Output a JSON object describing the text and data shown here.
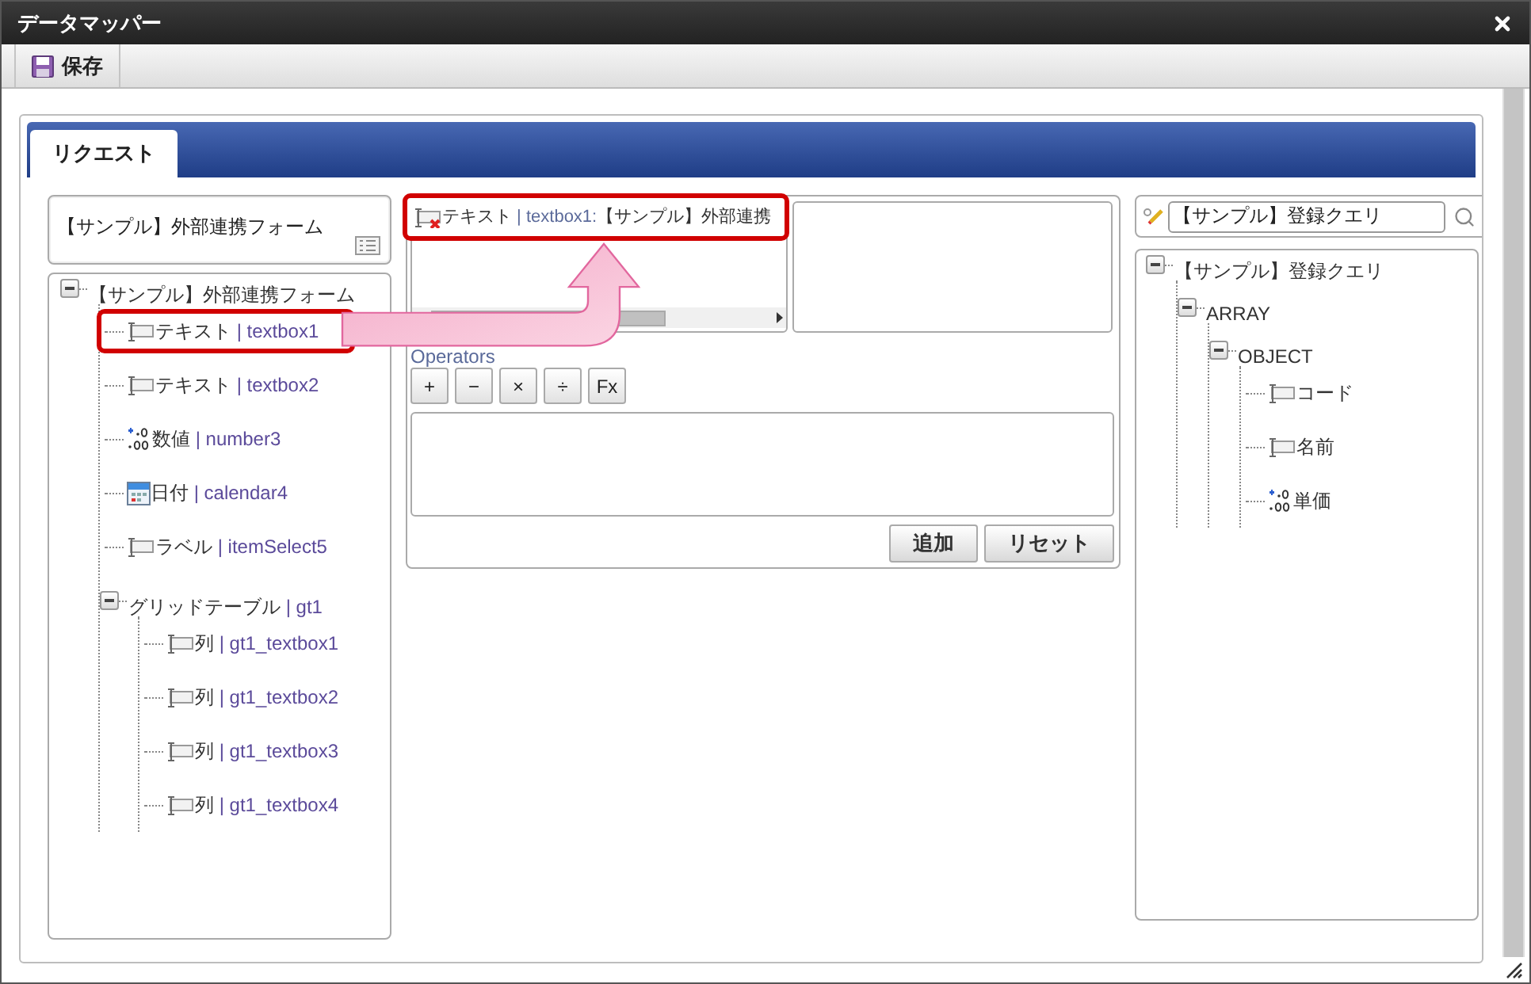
{
  "window": {
    "title": "データマッパー"
  },
  "toolbar": {
    "save_button": "保存"
  },
  "tabs": [
    {
      "label": "リクエスト",
      "selected": true
    }
  ],
  "source": {
    "title": "【サンプル】外部連携フォーム",
    "tree": [
      {
        "label": "【サンプル】外部連携フォーム",
        "expanded": true,
        "children": [
          {
            "kind": "text",
            "label": "テキスト",
            "ref": "| textbox1",
            "highlighted": true
          },
          {
            "kind": "text",
            "label": "テキスト",
            "ref": "| textbox2",
            "highlighted": false
          },
          {
            "kind": "number",
            "label": "数値",
            "ref": "| number3",
            "highlighted": false
          },
          {
            "kind": "date",
            "label": "日付",
            "ref": "| calendar4",
            "highlighted": false
          },
          {
            "kind": "text",
            "label": "ラベル",
            "ref": "| itemSelect5",
            "highlighted": false
          },
          {
            "label": "グリッドテーブル",
            "ref": "| gt1",
            "expanded": true,
            "children": [
              {
                "kind": "text",
                "label": "列",
                "ref": "| gt1_textbox1",
                "highlighted": false
              },
              {
                "kind": "text",
                "label": "列",
                "ref": "| gt1_textbox2",
                "highlighted": false
              },
              {
                "kind": "text",
                "label": "列",
                "ref": "| gt1_textbox3",
                "highlighted": false
              },
              {
                "kind": "text",
                "label": "列",
                "ref": "| gt1_textbox4",
                "highlighted": false
              }
            ]
          }
        ]
      }
    ]
  },
  "mapping": {
    "items": [
      {
        "label": "テキスト",
        "ref": "| textbox1:",
        "target": "【サンプル】外部連携",
        "highlighted": true
      }
    ],
    "operators_label": "Operators",
    "operators": [
      "+",
      "−",
      "×",
      "÷",
      "Fx"
    ],
    "buttons": [
      "追加",
      "リセット"
    ]
  },
  "target": {
    "search": {
      "value": "【サンプル】登録クエリ"
    },
    "tree": [
      {
        "label": "【サンプル】登録クエリ",
        "expanded": true,
        "children": [
          {
            "label": "ARRAY",
            "expanded": true,
            "children": [
              {
                "label": "OBJECT",
                "expanded": true,
                "children": [
                  {
                    "kind": "text",
                    "label": "コード"
                  },
                  {
                    "kind": "text",
                    "label": "名前"
                  },
                  {
                    "kind": "number",
                    "label": "単価"
                  }
                ]
              }
            ]
          }
        ]
      }
    ]
  }
}
